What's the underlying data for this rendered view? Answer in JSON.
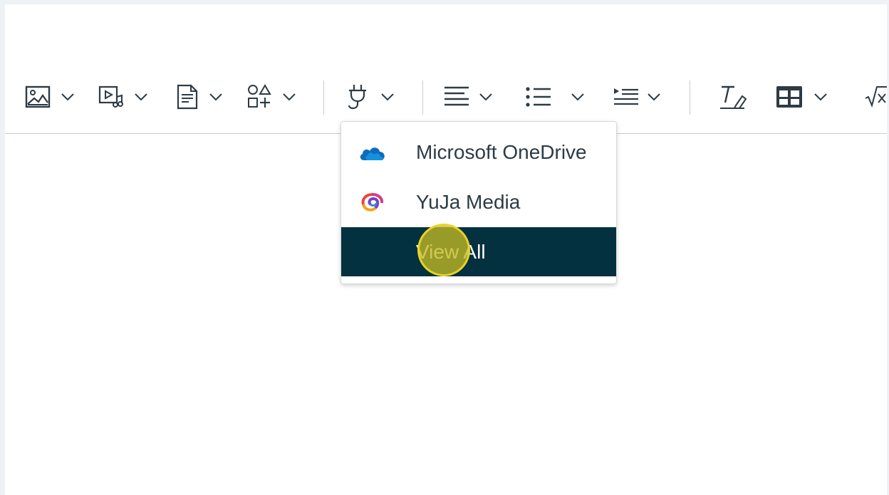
{
  "toolbar": {
    "buttons": [
      {
        "name": "image-icon"
      },
      {
        "name": "media-icon"
      },
      {
        "name": "document-icon"
      },
      {
        "name": "shapes-icon"
      },
      {
        "name": "plug-icon"
      },
      {
        "name": "align-icon"
      },
      {
        "name": "bullet-list-icon"
      },
      {
        "name": "indent-icon"
      },
      {
        "name": "clear-formatting-icon"
      },
      {
        "name": "table-icon"
      },
      {
        "name": "equation-icon"
      }
    ]
  },
  "apps_menu": {
    "items": [
      {
        "label": "Microsoft OneDrive",
        "icon": "onedrive-cloud-icon",
        "color": "#0f6cbd"
      },
      {
        "label": "YuJa Media",
        "icon": "yuja-logo-icon"
      },
      {
        "label": "View All",
        "active": true
      }
    ],
    "active_background": "#03313f"
  },
  "colors": {
    "icon": "#2d3b45",
    "divider": "#c7cdd1",
    "cursor_highlight": "#c4ba22"
  }
}
